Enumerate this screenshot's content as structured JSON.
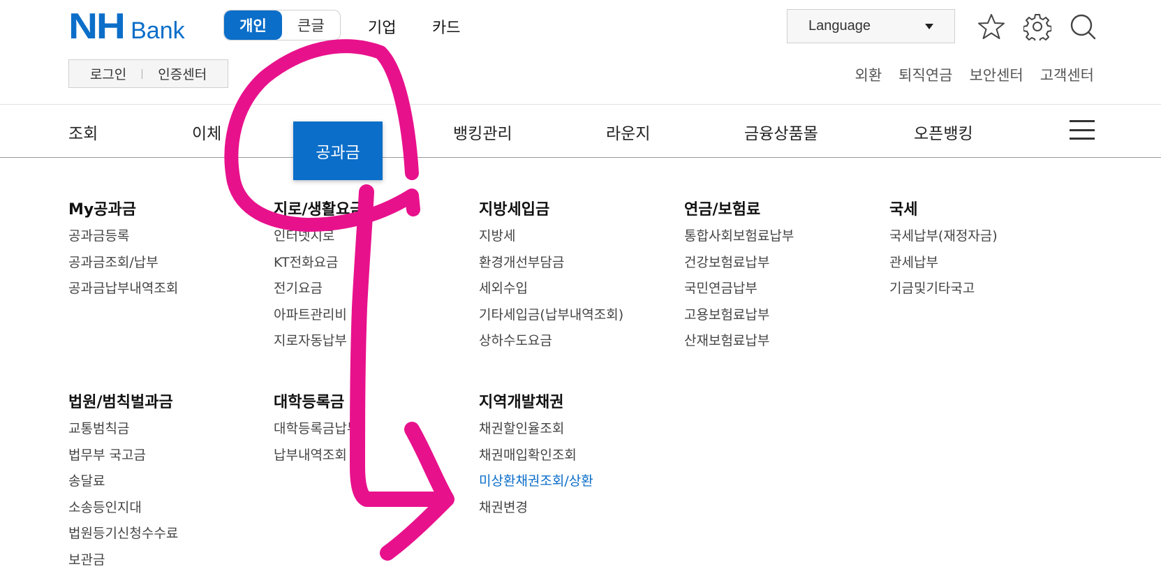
{
  "header": {
    "logo": {
      "nh": "NH",
      "bank": "Bank"
    },
    "mode_toggle": [
      {
        "label": "개인",
        "active": true
      },
      {
        "label": "큰글",
        "active": false
      }
    ],
    "top_links": [
      "기업",
      "카드"
    ],
    "language": {
      "label": "Language"
    },
    "icons": [
      "star-icon",
      "gear-icon",
      "search-icon"
    ],
    "login": {
      "login": "로그인",
      "cert": "인증센터"
    },
    "util_links": [
      "외환",
      "퇴직연금",
      "보안센터",
      "고객센터"
    ]
  },
  "gnb": {
    "items": [
      "조회",
      "이체",
      "공과금",
      "뱅킹관리",
      "라운지",
      "금융상품몰",
      "오픈뱅킹"
    ],
    "active_index": 2
  },
  "menu": {
    "columns": [
      {
        "title": "My공과금",
        "items": [
          "공과금등록",
          "공과금조회/납부",
          "공과금납부내역조회"
        ]
      },
      {
        "title": "지로/생활요금",
        "items": [
          "인터넷지로",
          "KT전화요금",
          "전기요금",
          "아파트관리비",
          "지로자동납부"
        ]
      },
      {
        "title": "지방세입금",
        "items": [
          "지방세",
          "환경개선부담금",
          "세외수입",
          "기타세입금(납부내역조회)",
          "상하수도요금"
        ]
      },
      {
        "title": "연금/보험료",
        "items": [
          "통합사회보험료납부",
          "건강보험료납부",
          "국민연금납부",
          "고용보험료납부",
          "산재보험료납부"
        ]
      },
      {
        "title": "국세",
        "items": [
          "국세납부(재정자금)",
          "관세납부",
          "기금및기타국고"
        ]
      },
      {
        "title": "법원/범칙벌과금",
        "items": [
          "교통범칙금",
          "법무부 국고금",
          "송달료",
          "소송등인지대",
          "법원등기신청수수료",
          "보관금"
        ]
      },
      {
        "title": "대학등록금",
        "items": [
          "대학등록금납부",
          "납부내역조회"
        ]
      },
      {
        "title": "지역개발채권",
        "items": [
          "채권할인율조회",
          "채권매입확인조회",
          "미상환채권조회/상환",
          "채권변경"
        ],
        "highlight_index": 2
      }
    ]
  },
  "colors": {
    "brand": "#0b6ec9",
    "annotation": "#e8118c"
  }
}
